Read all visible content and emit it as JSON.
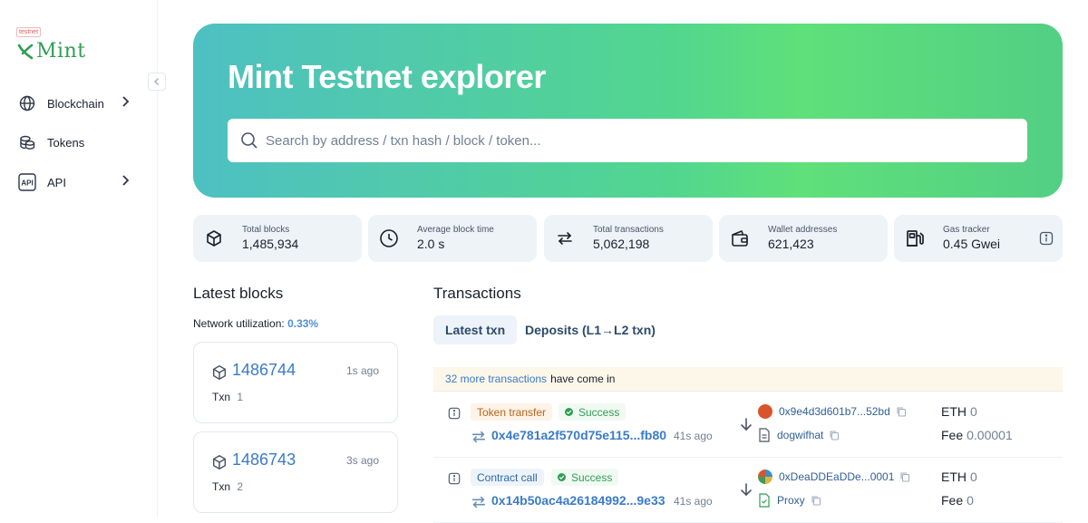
{
  "sidebar": {
    "logo_badge": "testnet",
    "logo_text": "Mint",
    "items": [
      {
        "label": "Blockchain",
        "icon": "globe-icon",
        "has_chevron": true
      },
      {
        "label": "Tokens",
        "icon": "coins-icon",
        "has_chevron": false
      },
      {
        "label": "API",
        "icon": "api-icon",
        "has_chevron": true
      }
    ]
  },
  "hero": {
    "title": "Mint Testnet explorer",
    "search_placeholder": "Search by address / txn hash / block / token..."
  },
  "stats": [
    {
      "label": "Total blocks",
      "value": "1,485,934",
      "icon": "cube-icon"
    },
    {
      "label": "Average block time",
      "value": "2.0 s",
      "icon": "clock-icon"
    },
    {
      "label": "Total transactions",
      "value": "5,062,198",
      "icon": "transfer-icon"
    },
    {
      "label": "Wallet addresses",
      "value": "621,423",
      "icon": "wallet-icon"
    },
    {
      "label": "Gas tracker",
      "value": "0.45 Gwei",
      "icon": "gas-pump-icon"
    }
  ],
  "latest_blocks": {
    "title": "Latest blocks",
    "utilization_label": "Network utilization:",
    "utilization_value": "0.33%",
    "blocks": [
      {
        "number": "1486744",
        "age": "1s ago",
        "txn_label": "Txn",
        "txn_count": "1"
      },
      {
        "number": "1486743",
        "age": "3s ago",
        "txn_label": "Txn",
        "txn_count": "2"
      }
    ]
  },
  "transactions": {
    "title": "Transactions",
    "tabs": [
      "Latest txn",
      "Deposits (L1→L2 txn)"
    ],
    "more_link": "32 more transactions",
    "more_suffix": "have come in",
    "rows": [
      {
        "type": "Token transfer",
        "status": "Success",
        "hash": "0x4e781a2f570d75e115...fb80",
        "age": "41s ago",
        "from": "0x9e4d3d601b7...52bd",
        "to": "dogwifhat",
        "value_label": "ETH",
        "value": "0",
        "fee_label": "Fee",
        "fee": "0.00001",
        "from_avatar_color": "#d9542b"
      },
      {
        "type": "Contract call",
        "status": "Success",
        "hash": "0x14b50ac4a26184992...9e33",
        "age": "41s ago",
        "from": "0xDeaDDEaDDe...0001",
        "to": "Proxy",
        "value_label": "ETH",
        "value": "0",
        "fee_label": "Fee",
        "fee": "0",
        "from_avatar_color": "#3b8fc8"
      }
    ]
  }
}
